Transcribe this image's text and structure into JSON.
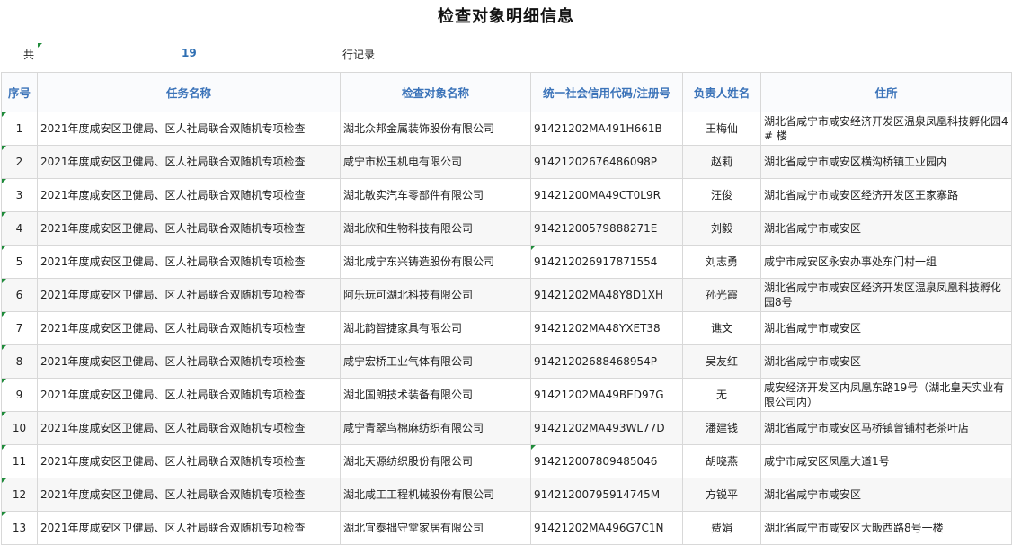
{
  "title": "检查对象明细信息",
  "summary": {
    "prefix": "共",
    "count": "19",
    "suffix": "行记录"
  },
  "headers": {
    "seq": "序号",
    "task": "任务名称",
    "target": "检查对象名称",
    "code": "统一社会信用代码/注册号",
    "person": "负责人姓名",
    "address": "住所"
  },
  "rows": [
    {
      "seq": "1",
      "task": "2021年度咸安区卫健局、区人社局联合双随机专项检查",
      "target": "湖北众邦金属装饰股份有限公司",
      "code": "91421202MA491H661B",
      "person": "王梅仙",
      "address": "湖北省咸宁市咸安经济开发区温泉凤凰科技孵化园4 # 楼"
    },
    {
      "seq": "2",
      "task": "2021年度咸安区卫健局、区人社局联合双随机专项检查",
      "target": "咸宁市松玉机电有限公司",
      "code": "91421202676486098P",
      "person": "赵莉",
      "address": "湖北省咸宁市咸安区横沟桥镇工业园内"
    },
    {
      "seq": "3",
      "task": "2021年度咸安区卫健局、区人社局联合双随机专项检查",
      "target": "湖北敏实汽车零部件有限公司",
      "code": "91421200MA49CT0L9R",
      "person": "汪俊",
      "address": "湖北省咸宁市咸安区经济开发区王家寨路"
    },
    {
      "seq": "4",
      "task": "2021年度咸安区卫健局、区人社局联合双随机专项检查",
      "target": "湖北欣和生物科技有限公司",
      "code": "91421200579888271E",
      "person": "刘毅",
      "address": "湖北省咸宁市咸安区"
    },
    {
      "seq": "5",
      "task": "2021年度咸安区卫健局、区人社局联合双随机专项检查",
      "target": "湖北咸宁东兴铸造股份有限公司",
      "code": "914212026917871554",
      "person": "刘志勇",
      "address": "咸宁市咸安区永安办事处东门村一组"
    },
    {
      "seq": "6",
      "task": "2021年度咸安区卫健局、区人社局联合双随机专项检查",
      "target": "阿乐玩可湖北科技有限公司",
      "code": "91421202MA48Y8D1XH",
      "person": "孙光霞",
      "address": "湖北省咸宁市咸安区经济开发区温泉凤凰科技孵化园8号"
    },
    {
      "seq": "7",
      "task": "2021年度咸安区卫健局、区人社局联合双随机专项检查",
      "target": "湖北韵智捷家具有限公司",
      "code": "91421202MA48YXET38",
      "person": "谯文",
      "address": "湖北省咸宁市咸安区"
    },
    {
      "seq": "8",
      "task": "2021年度咸安区卫健局、区人社局联合双随机专项检查",
      "target": "咸宁宏桥工业气体有限公司",
      "code": "91421202688468954P",
      "person": "吴友红",
      "address": "湖北省咸宁市咸安区"
    },
    {
      "seq": "9",
      "task": "2021年度咸安区卫健局、区人社局联合双随机专项检查",
      "target": "湖北国朗技术装备有限公司",
      "code": "91421202MA49BED97G",
      "person": "无",
      "address": "咸安经济开发区内凤凰东路19号（湖北皇天实业有限公司内）"
    },
    {
      "seq": "10",
      "task": "2021年度咸安区卫健局、区人社局联合双随机专项检查",
      "target": "咸宁青翠鸟棉麻纺织有限公司",
      "code": "91421202MA493WL77D",
      "person": "潘建钱",
      "address": "湖北省咸宁市咸安区马桥镇曾铺村老茶叶店"
    },
    {
      "seq": "11",
      "task": "2021年度咸安区卫健局、区人社局联合双随机专项检查",
      "target": "湖北天源纺织股份有限公司",
      "code": "914212007809485046",
      "person": "胡晓燕",
      "address": "咸宁市咸安区凤凰大道1号"
    },
    {
      "seq": "12",
      "task": "2021年度咸安区卫健局、区人社局联合双随机专项检查",
      "target": "湖北咸工工程机械股份有限公司",
      "code": "91421200795914745M",
      "person": "方锐平",
      "address": "湖北省咸宁市咸安区"
    },
    {
      "seq": "13",
      "task": "2021年度咸安区卫健局、区人社局联合双随机专项检查",
      "target": "湖北宜泰拙守堂家居有限公司",
      "code": "91421202MA496G7C1N",
      "person": "费娟",
      "address": "湖北省咸宁市咸安区大畈西路8号一楼"
    }
  ]
}
